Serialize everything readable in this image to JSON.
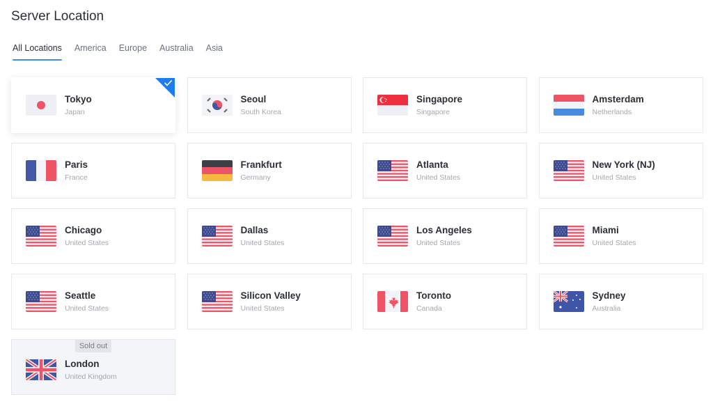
{
  "header": {
    "title": "Server Location"
  },
  "tabs": [
    {
      "label": "All Locations",
      "active": true
    },
    {
      "label": "America",
      "active": false
    },
    {
      "label": "Europe",
      "active": false
    },
    {
      "label": "Australia",
      "active": false
    },
    {
      "label": "Asia",
      "active": false
    }
  ],
  "locations": [
    {
      "city": "Tokyo",
      "country": "Japan",
      "flag": "japan-flag-icon",
      "selected": true
    },
    {
      "city": "Seoul",
      "country": "South Korea",
      "flag": "south-korea-flag-icon"
    },
    {
      "city": "Singapore",
      "country": "Singapore",
      "flag": "singapore-flag-icon"
    },
    {
      "city": "Amsterdam",
      "country": "Netherlands",
      "flag": "netherlands-flag-icon"
    },
    {
      "city": "Paris",
      "country": "France",
      "flag": "france-flag-icon"
    },
    {
      "city": "Frankfurt",
      "country": "Germany",
      "flag": "germany-flag-icon"
    },
    {
      "city": "Atlanta",
      "country": "United States",
      "flag": "usa-flag-icon"
    },
    {
      "city": "New York (NJ)",
      "country": "United States",
      "flag": "usa-flag-icon"
    },
    {
      "city": "Chicago",
      "country": "United States",
      "flag": "usa-flag-icon"
    },
    {
      "city": "Dallas",
      "country": "United States",
      "flag": "usa-flag-icon"
    },
    {
      "city": "Los Angeles",
      "country": "United States",
      "flag": "usa-flag-icon"
    },
    {
      "city": "Miami",
      "country": "United States",
      "flag": "usa-flag-icon"
    },
    {
      "city": "Seattle",
      "country": "United States",
      "flag": "usa-flag-icon"
    },
    {
      "city": "Silicon Valley",
      "country": "United States",
      "flag": "usa-flag-icon"
    },
    {
      "city": "Toronto",
      "country": "Canada",
      "flag": "canada-flag-icon"
    },
    {
      "city": "Sydney",
      "country": "Australia",
      "flag": "australia-flag-icon"
    },
    {
      "city": "London",
      "country": "United Kingdom",
      "flag": "uk-flag-icon",
      "sold_out": true,
      "badge": "Sold out"
    }
  ],
  "colors": {
    "accent": "#1f7cf0",
    "tab_underline": "#3c8eea"
  }
}
